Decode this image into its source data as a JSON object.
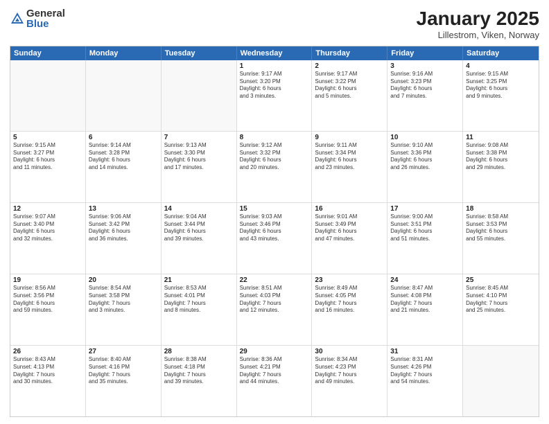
{
  "header": {
    "logo": {
      "general": "General",
      "blue": "Blue"
    },
    "title": "January 2025",
    "subtitle": "Lillestrom, Viken, Norway"
  },
  "calendar": {
    "days": [
      "Sunday",
      "Monday",
      "Tuesday",
      "Wednesday",
      "Thursday",
      "Friday",
      "Saturday"
    ],
    "weeks": [
      [
        {
          "day": "",
          "text": ""
        },
        {
          "day": "",
          "text": ""
        },
        {
          "day": "",
          "text": ""
        },
        {
          "day": "1",
          "text": "Sunrise: 9:17 AM\nSunset: 3:20 PM\nDaylight: 6 hours\nand 3 minutes."
        },
        {
          "day": "2",
          "text": "Sunrise: 9:17 AM\nSunset: 3:22 PM\nDaylight: 6 hours\nand 5 minutes."
        },
        {
          "day": "3",
          "text": "Sunrise: 9:16 AM\nSunset: 3:23 PM\nDaylight: 6 hours\nand 7 minutes."
        },
        {
          "day": "4",
          "text": "Sunrise: 9:15 AM\nSunset: 3:25 PM\nDaylight: 6 hours\nand 9 minutes."
        }
      ],
      [
        {
          "day": "5",
          "text": "Sunrise: 9:15 AM\nSunset: 3:27 PM\nDaylight: 6 hours\nand 11 minutes."
        },
        {
          "day": "6",
          "text": "Sunrise: 9:14 AM\nSunset: 3:28 PM\nDaylight: 6 hours\nand 14 minutes."
        },
        {
          "day": "7",
          "text": "Sunrise: 9:13 AM\nSunset: 3:30 PM\nDaylight: 6 hours\nand 17 minutes."
        },
        {
          "day": "8",
          "text": "Sunrise: 9:12 AM\nSunset: 3:32 PM\nDaylight: 6 hours\nand 20 minutes."
        },
        {
          "day": "9",
          "text": "Sunrise: 9:11 AM\nSunset: 3:34 PM\nDaylight: 6 hours\nand 23 minutes."
        },
        {
          "day": "10",
          "text": "Sunrise: 9:10 AM\nSunset: 3:36 PM\nDaylight: 6 hours\nand 26 minutes."
        },
        {
          "day": "11",
          "text": "Sunrise: 9:08 AM\nSunset: 3:38 PM\nDaylight: 6 hours\nand 29 minutes."
        }
      ],
      [
        {
          "day": "12",
          "text": "Sunrise: 9:07 AM\nSunset: 3:40 PM\nDaylight: 6 hours\nand 32 minutes."
        },
        {
          "day": "13",
          "text": "Sunrise: 9:06 AM\nSunset: 3:42 PM\nDaylight: 6 hours\nand 36 minutes."
        },
        {
          "day": "14",
          "text": "Sunrise: 9:04 AM\nSunset: 3:44 PM\nDaylight: 6 hours\nand 39 minutes."
        },
        {
          "day": "15",
          "text": "Sunrise: 9:03 AM\nSunset: 3:46 PM\nDaylight: 6 hours\nand 43 minutes."
        },
        {
          "day": "16",
          "text": "Sunrise: 9:01 AM\nSunset: 3:49 PM\nDaylight: 6 hours\nand 47 minutes."
        },
        {
          "day": "17",
          "text": "Sunrise: 9:00 AM\nSunset: 3:51 PM\nDaylight: 6 hours\nand 51 minutes."
        },
        {
          "day": "18",
          "text": "Sunrise: 8:58 AM\nSunset: 3:53 PM\nDaylight: 6 hours\nand 55 minutes."
        }
      ],
      [
        {
          "day": "19",
          "text": "Sunrise: 8:56 AM\nSunset: 3:56 PM\nDaylight: 6 hours\nand 59 minutes."
        },
        {
          "day": "20",
          "text": "Sunrise: 8:54 AM\nSunset: 3:58 PM\nDaylight: 7 hours\nand 3 minutes."
        },
        {
          "day": "21",
          "text": "Sunrise: 8:53 AM\nSunset: 4:01 PM\nDaylight: 7 hours\nand 8 minutes."
        },
        {
          "day": "22",
          "text": "Sunrise: 8:51 AM\nSunset: 4:03 PM\nDaylight: 7 hours\nand 12 minutes."
        },
        {
          "day": "23",
          "text": "Sunrise: 8:49 AM\nSunset: 4:05 PM\nDaylight: 7 hours\nand 16 minutes."
        },
        {
          "day": "24",
          "text": "Sunrise: 8:47 AM\nSunset: 4:08 PM\nDaylight: 7 hours\nand 21 minutes."
        },
        {
          "day": "25",
          "text": "Sunrise: 8:45 AM\nSunset: 4:10 PM\nDaylight: 7 hours\nand 25 minutes."
        }
      ],
      [
        {
          "day": "26",
          "text": "Sunrise: 8:43 AM\nSunset: 4:13 PM\nDaylight: 7 hours\nand 30 minutes."
        },
        {
          "day": "27",
          "text": "Sunrise: 8:40 AM\nSunset: 4:16 PM\nDaylight: 7 hours\nand 35 minutes."
        },
        {
          "day": "28",
          "text": "Sunrise: 8:38 AM\nSunset: 4:18 PM\nDaylight: 7 hours\nand 39 minutes."
        },
        {
          "day": "29",
          "text": "Sunrise: 8:36 AM\nSunset: 4:21 PM\nDaylight: 7 hours\nand 44 minutes."
        },
        {
          "day": "30",
          "text": "Sunrise: 8:34 AM\nSunset: 4:23 PM\nDaylight: 7 hours\nand 49 minutes."
        },
        {
          "day": "31",
          "text": "Sunrise: 8:31 AM\nSunset: 4:26 PM\nDaylight: 7 hours\nand 54 minutes."
        },
        {
          "day": "",
          "text": ""
        }
      ]
    ]
  }
}
